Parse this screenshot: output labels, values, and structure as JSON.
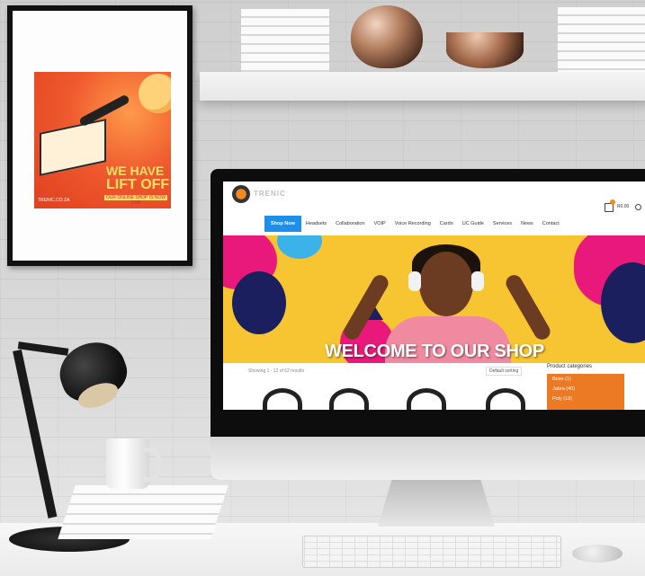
{
  "poster": {
    "headline_line1": "WE HAVE",
    "headline_line2": "LIFT OFF",
    "tagline": "OUR ONLINE SHOP IS NOW LIVE",
    "footer": "TRENIC.CO.ZA"
  },
  "website": {
    "brand": "TRENIC",
    "cart_amount": "R0.00",
    "nav": [
      "Shop Now",
      "Headsets",
      "Collaboration",
      "VOIP",
      "Voice Recording",
      "Cardo",
      "UC Guide",
      "Services",
      "News",
      "Contact"
    ],
    "active_nav_index": 0,
    "hero_title": "WELCOME TO OUR SHOP",
    "results_text": "Showing 1 - 12 of 62 results",
    "sort_label": "Default sorting",
    "categories_title": "Product categories",
    "categories": [
      "Bose (1)",
      "Jabra (40)",
      "Poly (19)"
    ]
  },
  "colors": {
    "nav_active": "#1e8fe8",
    "hero_background": "#f7c531",
    "category_box": "#ec7a24",
    "accent_pink": "#e8197a",
    "accent_navy": "#1b1f5e"
  },
  "icons": [
    "cart-icon",
    "search-icon",
    "site-logo"
  ]
}
